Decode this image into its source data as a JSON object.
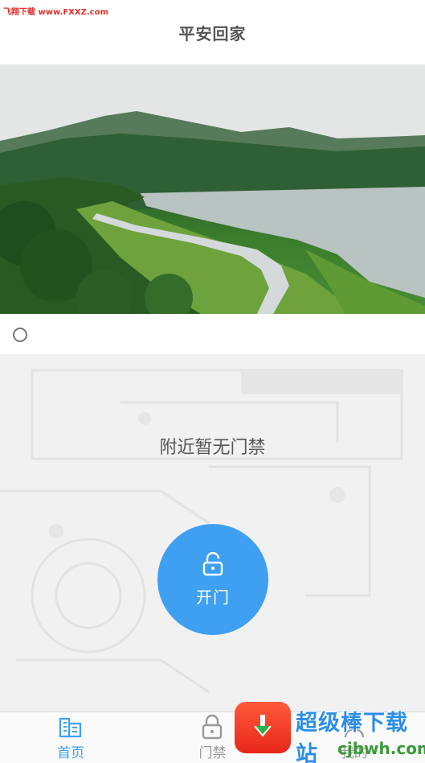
{
  "watermark": {
    "top_text": "飞翔下载 www.FXXZ.com",
    "brand": "超级棒下载站",
    "url": "cjbwh.com"
  },
  "header": {
    "title": "平安回家"
  },
  "main": {
    "empty_message": "附近暂无门禁",
    "open_button_label": "开门"
  },
  "tabs": [
    {
      "label": "首页",
      "icon": "building-icon",
      "active": true
    },
    {
      "label": "门禁",
      "icon": "lock-icon",
      "active": false
    },
    {
      "label": "我的",
      "icon": "person-icon",
      "active": false
    }
  ],
  "colors": {
    "accent": "#3f9ff0",
    "background": "#f1f1f1",
    "inactive": "#999999"
  }
}
